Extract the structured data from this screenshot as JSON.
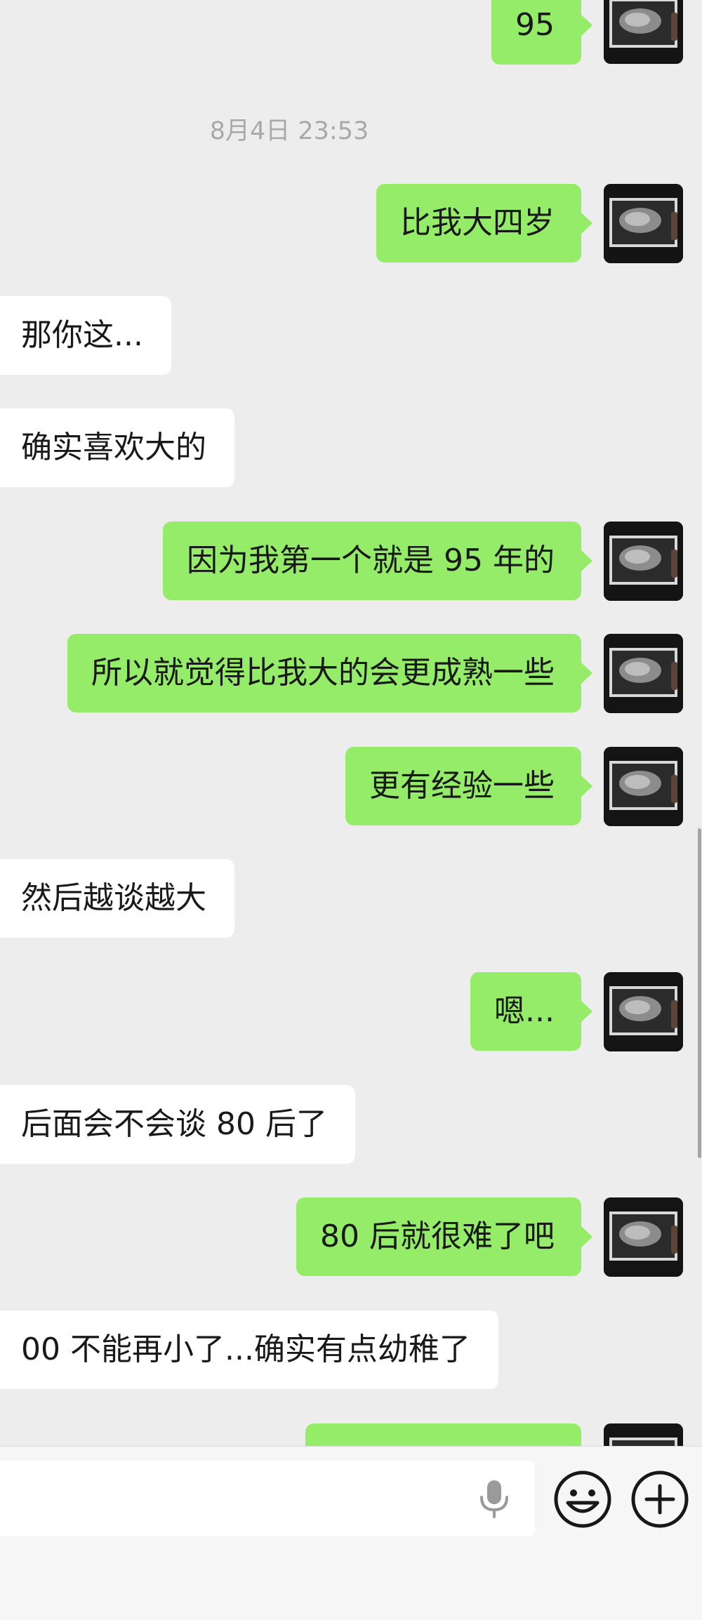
{
  "chat": {
    "timestamp": "8月4日 23:53",
    "messages": [
      {
        "side": "out",
        "text": "95"
      },
      {
        "side": "out",
        "text": "比我大四岁"
      },
      {
        "side": "in",
        "text": "那你这..."
      },
      {
        "side": "in",
        "text": "确实喜欢大的"
      },
      {
        "side": "out",
        "text": "因为我第一个就是 95 年的"
      },
      {
        "side": "out",
        "text": "所以就觉得比我大的会更成熟一些"
      },
      {
        "side": "out",
        "text": "更有经验一些"
      },
      {
        "side": "in",
        "text": "然后越谈越大"
      },
      {
        "side": "out",
        "text": "嗯..."
      },
      {
        "side": "in",
        "text": "后面会不会谈 80 后了"
      },
      {
        "side": "out",
        "text": "80 后就很难了吧"
      },
      {
        "side": "in",
        "text": "00 不能再小了...确实有点幼稚了"
      }
    ]
  },
  "colors": {
    "outgoing_bubble": "#95ec69",
    "incoming_bubble": "#ffffff",
    "background": "#ededed",
    "timestamp": "#a9a9a9"
  },
  "input_bar": {
    "icons": [
      "microphone-icon",
      "emoji-icon",
      "add-icon"
    ]
  }
}
